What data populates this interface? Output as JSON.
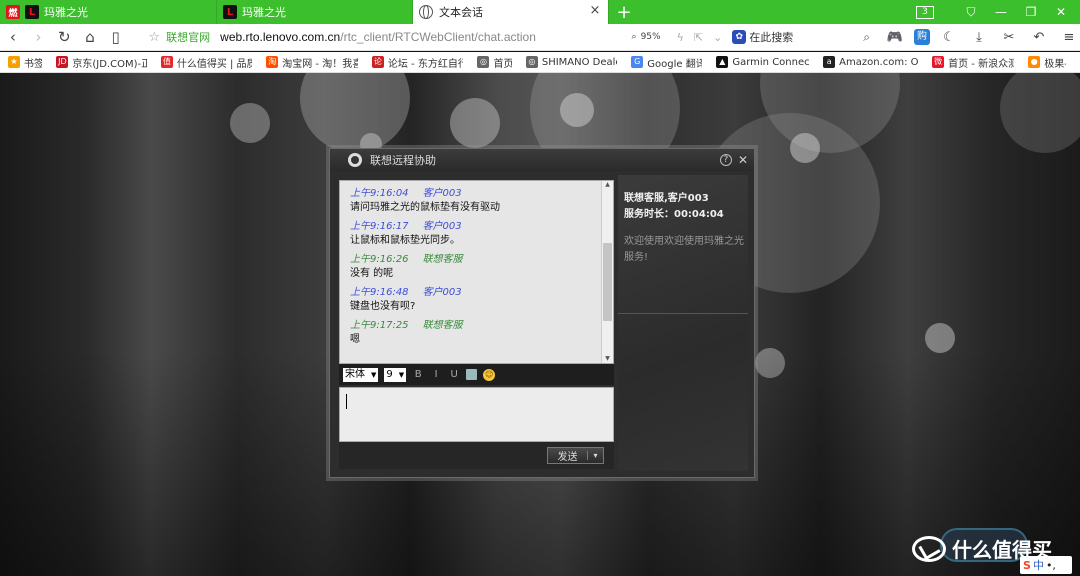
{
  "tabs": [
    {
      "title": "玛雅之光",
      "icon": "brand-icon"
    },
    {
      "title": "玛雅之光",
      "icon": "brand-icon"
    },
    {
      "title": "文本会话",
      "icon": "globe-icon",
      "active": true
    }
  ],
  "tab_count": "3",
  "address_bar": {
    "site_name": "联想官网",
    "url_host": "web.rto.lenovo.com.cn",
    "url_path": "/rtc_client/RTCWebClient/chat.action",
    "zoom": "95%"
  },
  "search": {
    "placeholder": "在此搜索"
  },
  "bookmarks": [
    {
      "label": "书签",
      "color": "#f5a000"
    },
    {
      "label": "京东(JD.COM)-正",
      "color": "#c81623"
    },
    {
      "label": "什么值得买 | 品质",
      "color": "#e62828"
    },
    {
      "label": "淘宝网 - 淘！我喜",
      "color": "#ff5000"
    },
    {
      "label": "论坛 - 东方红自行",
      "color": "#cc2222"
    },
    {
      "label": "首页",
      "color": "#666666"
    },
    {
      "label": "SHIMANO Deale",
      "color": "#666666"
    },
    {
      "label": "Google 翻译",
      "color": "#4a87f0"
    },
    {
      "label": "Garmin Connect",
      "color": "#111111"
    },
    {
      "label": "Amazon.com: Or",
      "color": "#222222"
    },
    {
      "label": "首页 - 新浪众测",
      "color": "#e6162d"
    },
    {
      "label": "极果-",
      "color": "#ff8a00"
    }
  ],
  "dialog": {
    "title": "联想远程协助",
    "messages": [
      {
        "time": "上午9:16:04",
        "sender": "客户003",
        "role": "customer",
        "text": "请问玛雅之光的鼠标垫有没有驱动"
      },
      {
        "time": "上午9:16:17",
        "sender": "客户003",
        "role": "customer",
        "text": "让鼠标和鼠标垫光同步。"
      },
      {
        "time": "上午9:16:26",
        "sender": "联想客服",
        "role": "agent",
        "text": "没有 的呢"
      },
      {
        "time": "上午9:16:48",
        "sender": "客户003",
        "role": "customer",
        "text": "键盘也没有呗?"
      },
      {
        "time": "上午9:17:25",
        "sender": "联想客服",
        "role": "agent",
        "text": "嗯"
      }
    ],
    "font_name": "宋体",
    "font_size": "9",
    "format_buttons": [
      "B",
      "I",
      "U"
    ],
    "input_value": "",
    "send_label": "发送",
    "info": {
      "line1": "联想客服,客户003",
      "line2": "服务时长：00:04:04",
      "welcome": "欢迎使用欢迎使用玛雅之光服务!"
    }
  },
  "watermark": "什么值得买",
  "ime": {
    "s": "S",
    "lang": "中",
    "punct": "•,"
  },
  "colors": {
    "brand_green": "#3cbf2c",
    "customer_name": "#3b4fd8",
    "agent_name": "#3a8a3c"
  }
}
